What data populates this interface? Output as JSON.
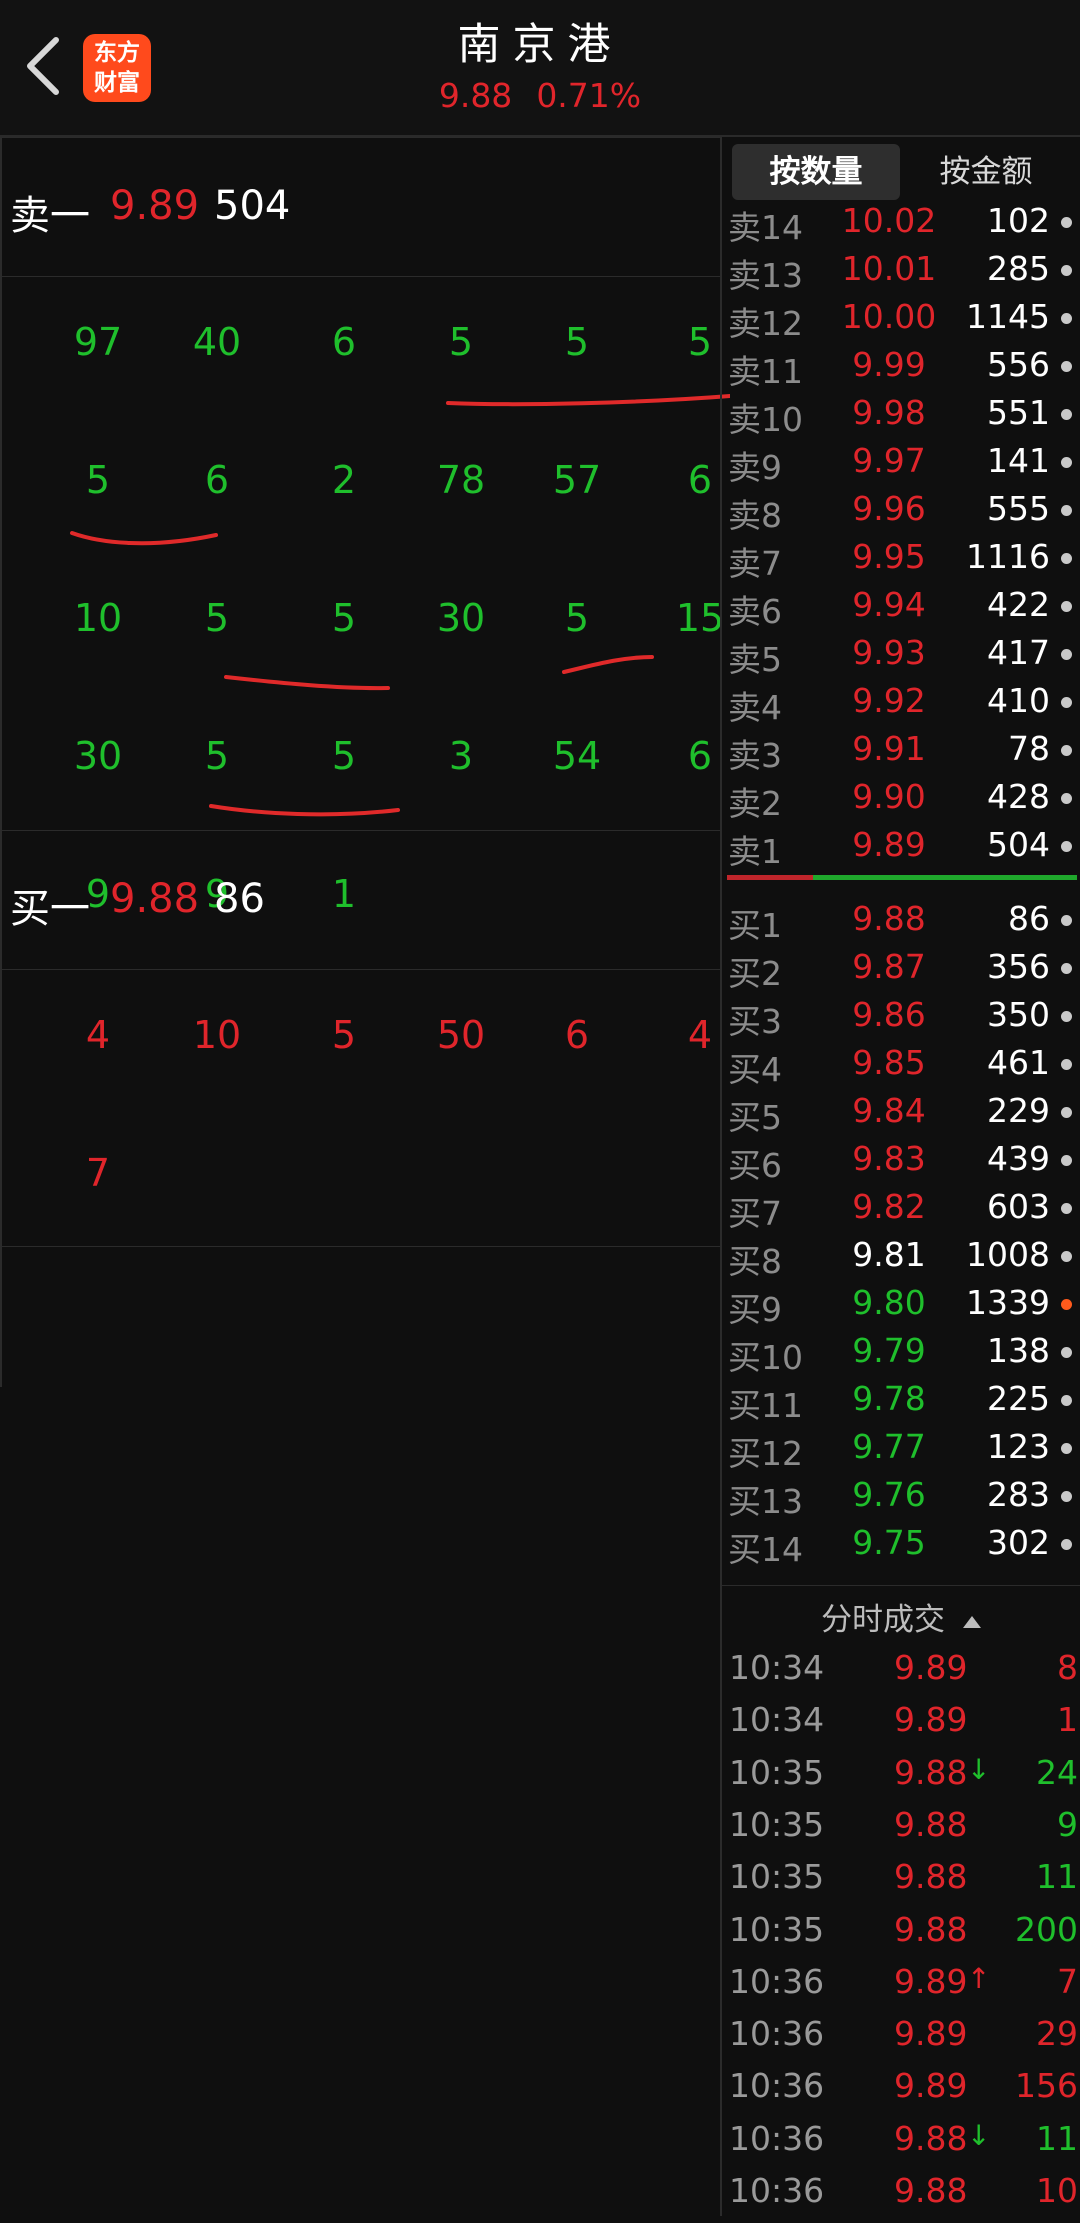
{
  "header": {
    "title": "南京港",
    "price": "9.88",
    "change_pct": "0.71%",
    "logo_line1": "东方",
    "logo_line2": "财富"
  },
  "sell_one": {
    "label": "卖一",
    "price": "9.89",
    "volume": "504"
  },
  "sell_queue": [
    [
      "97",
      "40",
      "6",
      "5",
      "5",
      "5"
    ],
    [
      "5",
      "6",
      "2",
      "78",
      "57",
      "6"
    ],
    [
      "10",
      "5",
      "5",
      "30",
      "5",
      "15"
    ],
    [
      "30",
      "5",
      "5",
      "3",
      "54",
      "6"
    ],
    [
      "9",
      "9",
      "1"
    ]
  ],
  "buy_one": {
    "label": "买一",
    "price": "9.88",
    "volume": "86"
  },
  "buy_queue": [
    [
      "4",
      "10",
      "5",
      "50",
      "6",
      "4"
    ],
    [
      "7"
    ]
  ],
  "toggle": {
    "by_quantity": "按数量",
    "by_amount": "按金额"
  },
  "asks": [
    {
      "label": "卖14",
      "price": "10.02",
      "volume": "102"
    },
    {
      "label": "卖13",
      "price": "10.01",
      "volume": "285"
    },
    {
      "label": "卖12",
      "price": "10.00",
      "volume": "1145"
    },
    {
      "label": "卖11",
      "price": "9.99",
      "volume": "556"
    },
    {
      "label": "卖10",
      "price": "9.98",
      "volume": "551"
    },
    {
      "label": "卖9",
      "price": "9.97",
      "volume": "141"
    },
    {
      "label": "卖8",
      "price": "9.96",
      "volume": "555"
    },
    {
      "label": "卖7",
      "price": "9.95",
      "volume": "1116"
    },
    {
      "label": "卖6",
      "price": "9.94",
      "volume": "422"
    },
    {
      "label": "卖5",
      "price": "9.93",
      "volume": "417"
    },
    {
      "label": "卖4",
      "price": "9.92",
      "volume": "410"
    },
    {
      "label": "卖3",
      "price": "9.91",
      "volume": "78"
    },
    {
      "label": "卖2",
      "price": "9.90",
      "volume": "428"
    },
    {
      "label": "卖1",
      "price": "9.89",
      "volume": "504"
    }
  ],
  "bids": [
    {
      "label": "买1",
      "price": "9.88",
      "volume": "86",
      "color": "red"
    },
    {
      "label": "买2",
      "price": "9.87",
      "volume": "356",
      "color": "red"
    },
    {
      "label": "买3",
      "price": "9.86",
      "volume": "350",
      "color": "red"
    },
    {
      "label": "买4",
      "price": "9.85",
      "volume": "461",
      "color": "red"
    },
    {
      "label": "买5",
      "price": "9.84",
      "volume": "229",
      "color": "red"
    },
    {
      "label": "买6",
      "price": "9.83",
      "volume": "439",
      "color": "red"
    },
    {
      "label": "买7",
      "price": "9.82",
      "volume": "603",
      "color": "red"
    },
    {
      "label": "买8",
      "price": "9.81",
      "volume": "1008",
      "color": "white"
    },
    {
      "label": "买9",
      "price": "9.80",
      "volume": "1339",
      "color": "green",
      "dot": "orange"
    },
    {
      "label": "买10",
      "price": "9.79",
      "volume": "138",
      "color": "green"
    },
    {
      "label": "买11",
      "price": "9.78",
      "volume": "225",
      "color": "green"
    },
    {
      "label": "买12",
      "price": "9.77",
      "volume": "123",
      "color": "green"
    },
    {
      "label": "买13",
      "price": "9.76",
      "volume": "283",
      "color": "green"
    },
    {
      "label": "买14",
      "price": "9.75",
      "volume": "302",
      "color": "green"
    }
  ],
  "trades_title": "分时成交",
  "trades": [
    {
      "time": "10:34",
      "price": "9.89",
      "arrow": "",
      "volume": "8",
      "vcolor": "red"
    },
    {
      "time": "10:34",
      "price": "9.89",
      "arrow": "",
      "volume": "1",
      "vcolor": "red"
    },
    {
      "time": "10:35",
      "price": "9.88",
      "arrow": "↓",
      "volume": "24",
      "vcolor": "green"
    },
    {
      "time": "10:35",
      "price": "9.88",
      "arrow": "",
      "volume": "9",
      "vcolor": "green"
    },
    {
      "time": "10:35",
      "price": "9.88",
      "arrow": "",
      "volume": "11",
      "vcolor": "green"
    },
    {
      "time": "10:35",
      "price": "9.88",
      "arrow": "",
      "volume": "200",
      "vcolor": "green"
    },
    {
      "time": "10:36",
      "price": "9.89",
      "arrow": "↑",
      "volume": "7",
      "vcolor": "red"
    },
    {
      "time": "10:36",
      "price": "9.89",
      "arrow": "",
      "volume": "29",
      "vcolor": "red"
    },
    {
      "time": "10:36",
      "price": "9.89",
      "arrow": "",
      "volume": "156",
      "vcolor": "red"
    },
    {
      "time": "10:36",
      "price": "9.88",
      "arrow": "↓",
      "volume": "11",
      "vcolor": "green"
    },
    {
      "time": "10:36",
      "price": "9.88",
      "arrow": "",
      "volume": "10",
      "vcolor": "red"
    }
  ]
}
